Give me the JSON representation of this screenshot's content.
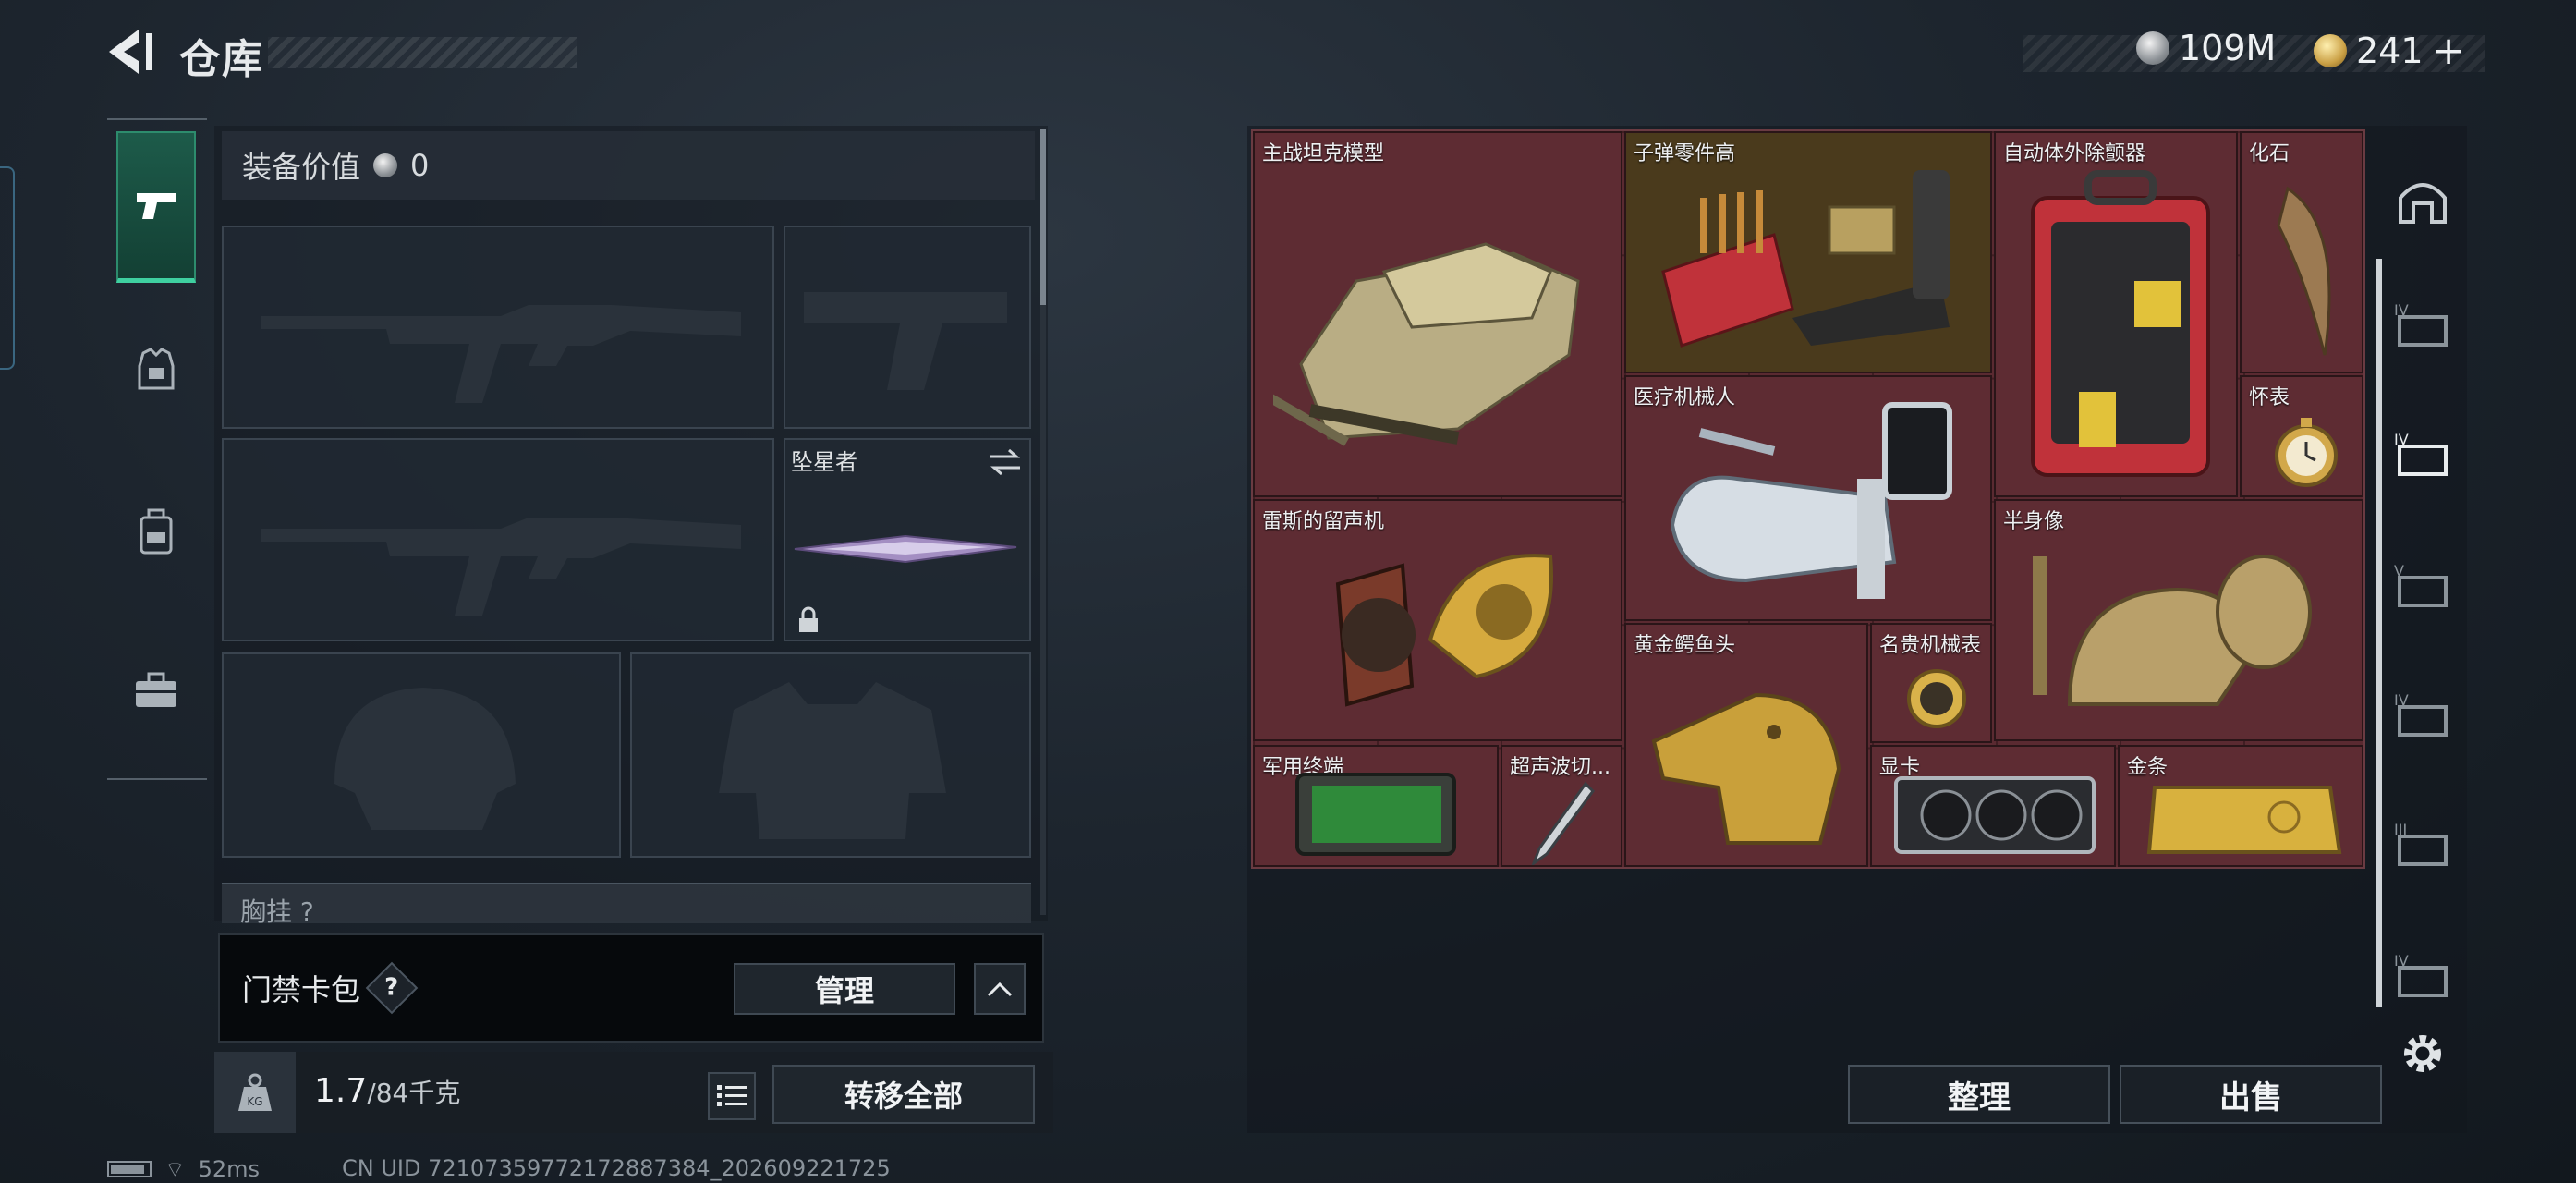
{
  "header": {
    "title": "仓库",
    "currencies": [
      {
        "icon": "silver-coin-icon",
        "value": "109M"
      },
      {
        "icon": "gold-coin-icon",
        "value": "241",
        "suffix": "+"
      }
    ]
  },
  "left_nav": {
    "items": [
      {
        "icon": "pistol-icon",
        "active": true
      },
      {
        "icon": "armor-vest-icon",
        "active": false
      },
      {
        "icon": "backpack-icon",
        "active": false
      },
      {
        "icon": "briefcase-icon",
        "active": false
      }
    ]
  },
  "equipment": {
    "value_label": "装备价值",
    "value": "0",
    "slots": {
      "primary_weapon_1": "rifle-silhouette-icon",
      "sidearm": "pistol-silhouette-icon",
      "primary_weapon_2": "rifle-silhouette-icon",
      "melee_name": "坠星者",
      "helmet": "helmet-silhouette-icon",
      "armor": "vest-silhouette-icon"
    },
    "chest_peek": "胸挂 ?"
  },
  "keycard": {
    "label": "门禁卡包",
    "help": "?",
    "manage": "管理"
  },
  "weight": {
    "kg_icon_label": "KG",
    "current": "1.7",
    "max": "/84千克",
    "transfer_all": "转移全部"
  },
  "storage": {
    "items": [
      {
        "name": "主战坦克模型"
      },
      {
        "name": "子弹零件高"
      },
      {
        "name": "自动体外除颤器"
      },
      {
        "name": "化石"
      },
      {
        "name": "医疗机械人"
      },
      {
        "name": "怀表"
      },
      {
        "name": "雷斯的留声机"
      },
      {
        "name": "半身像"
      },
      {
        "name": "黄金鳄鱼头"
      },
      {
        "name": "名贵机械表"
      },
      {
        "name": "军用终端"
      },
      {
        "name": "超声波切..."
      },
      {
        "name": "显卡"
      },
      {
        "name": "金条"
      }
    ],
    "arrange": "整理",
    "sell": "出售"
  },
  "right_tabs": [
    {
      "label": "IV"
    },
    {
      "label": "IV"
    },
    {
      "label": "V"
    },
    {
      "label": "IV"
    },
    {
      "label": "III"
    },
    {
      "label": "IV"
    }
  ],
  "status_bar": {
    "ping": "52ms",
    "uid": "CN UID 7210735977217288738​4_202609221725"
  },
  "colors": {
    "accent_green": "#3fd0a0",
    "red_rarity": "#5e2c33",
    "gold_rarity": "#4a3a1c"
  }
}
